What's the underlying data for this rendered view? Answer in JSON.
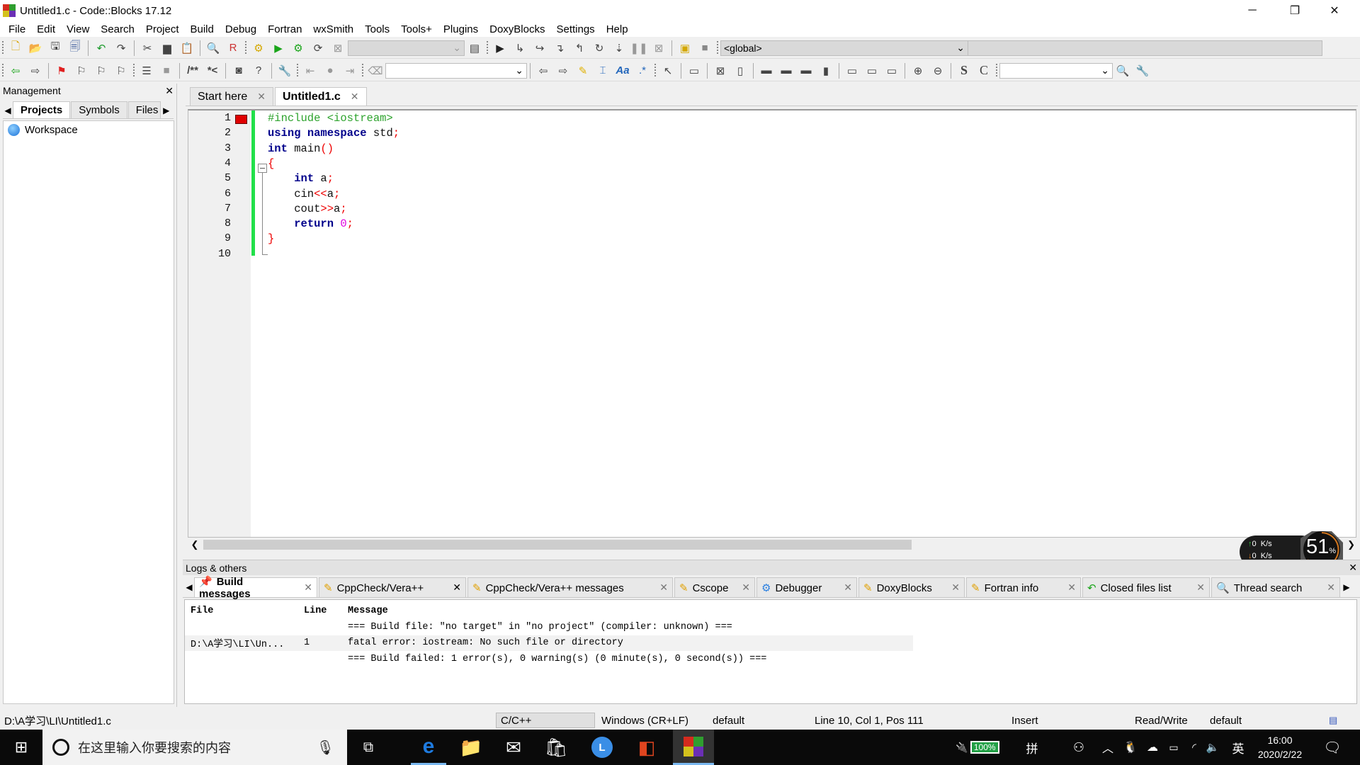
{
  "window": {
    "title": "Untitled1.c - Code::Blocks 17.12",
    "controls": {
      "minimize": "─",
      "restore": "❐",
      "close": "✕"
    }
  },
  "menu": [
    "File",
    "Edit",
    "View",
    "Search",
    "Project",
    "Build",
    "Debug",
    "Fortran",
    "wxSmith",
    "Tools",
    "Tools+",
    "Plugins",
    "DoxyBlocks",
    "Settings",
    "Help"
  ],
  "toolbar": {
    "scope_combo": "<global>",
    "build_target_combo": "",
    "search_combo": "",
    "thread_search_combo": ""
  },
  "management": {
    "title": "Management",
    "close": "✕",
    "tabs": [
      "Projects",
      "Symbols",
      "Files"
    ],
    "active_tab": "Projects",
    "tree": {
      "workspace": "Workspace"
    }
  },
  "editor": {
    "tabs": [
      {
        "label": "Start here",
        "active": false
      },
      {
        "label": "Untitled1.c",
        "active": true
      }
    ],
    "line_numbers": [
      "1",
      "2",
      "3",
      "4",
      "5",
      "6",
      "7",
      "8",
      "9",
      "10"
    ],
    "code_lines": [
      "#include <iostream>",
      "using namespace std;",
      "int main()",
      "{",
      "    int a;",
      "    cin<<a;",
      "    cout>>a;",
      "    return 0;",
      "}",
      ""
    ],
    "bookmark_line": 1
  },
  "logs": {
    "title": "Logs & others",
    "close": "✕",
    "tabs": [
      {
        "label": "Build messages",
        "icon": "pin-icon",
        "active": true
      },
      {
        "label": "CppCheck/Vera++",
        "icon": "pencil-icon",
        "active": false
      },
      {
        "label": "CppCheck/Vera++ messages",
        "icon": "pencil-icon",
        "active": false
      },
      {
        "label": "Cscope",
        "icon": "pencil-icon",
        "active": false
      },
      {
        "label": "Debugger",
        "icon": "gear-icon",
        "active": false
      },
      {
        "label": "DoxyBlocks",
        "icon": "pencil-icon",
        "active": false
      },
      {
        "label": "Fortran info",
        "icon": "pencil-icon",
        "active": false
      },
      {
        "label": "Closed files list",
        "icon": "undo-arrow-icon",
        "active": false
      },
      {
        "label": "Thread search",
        "icon": "magnifier-icon",
        "active": false
      }
    ],
    "columns": [
      "File",
      "Line",
      "Message"
    ],
    "rows": [
      {
        "file": "",
        "line": "",
        "message": "=== Build file: \"no target\" in \"no project\" (compiler: unknown) ==="
      },
      {
        "file": "D:\\A学习\\LI\\Un...",
        "line": "1",
        "message": "fatal error: iostream: No such file or directory"
      },
      {
        "file": "",
        "line": "",
        "message": "=== Build failed: 1 error(s), 0 warning(s) (0 minute(s), 0 second(s)) ==="
      }
    ]
  },
  "statusbar": {
    "path": "D:\\A学习\\LI\\Untitled1.c",
    "language": "C/C++",
    "eol": "Windows (CR+LF)",
    "encoding": "default",
    "position": "Line 10, Col 1, Pos 111",
    "mode": "Insert",
    "access": "Read/Write",
    "profile": "default"
  },
  "netmon": {
    "up": "0",
    "down": "0",
    "unit": "K/s",
    "percent": "51",
    "percent_sign": "%"
  },
  "taskbar": {
    "search_placeholder": "在这里输入你要搜索的内容",
    "battery": "100%",
    "ime": "拼",
    "lang": "英",
    "time": "16:00",
    "date": "2020/2/22"
  }
}
